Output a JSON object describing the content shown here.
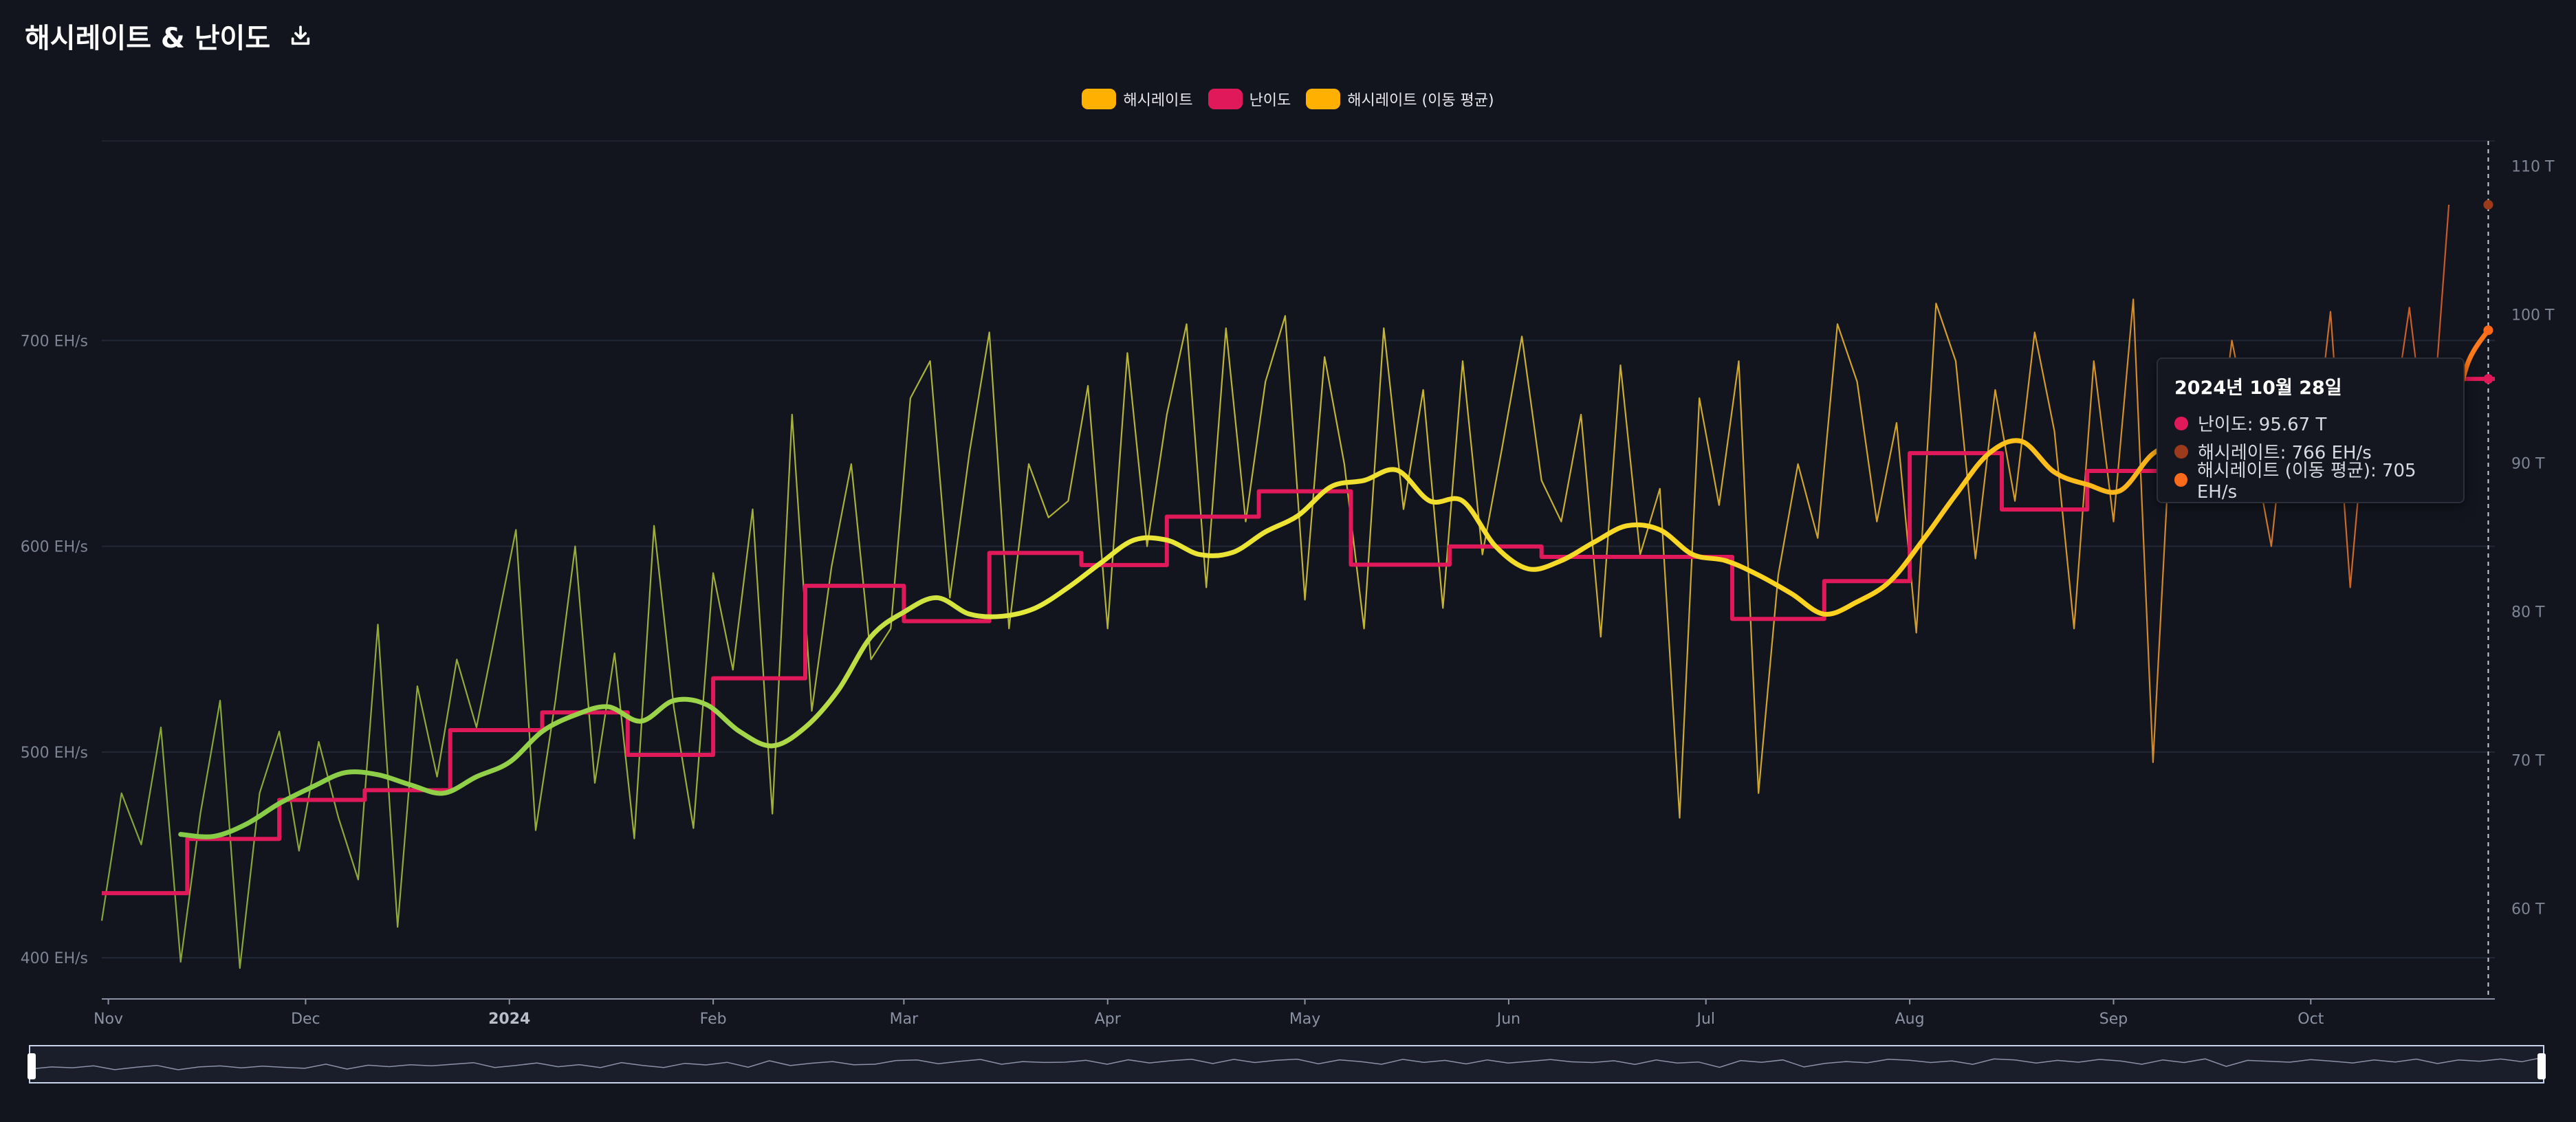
{
  "header": {
    "title": "해시레이트 & 난이도"
  },
  "icons": {
    "download": "download-icon"
  },
  "legend": [
    {
      "label": "해시레이트",
      "color": "#ffb000"
    },
    {
      "label": "난이도",
      "color": "#e0195a"
    },
    {
      "label": "해시레이트 (이동 평균)",
      "color": "#ffb000"
    }
  ],
  "tooltip": {
    "date": "2024년 10월 28일",
    "rows": [
      {
        "text": "난이도: 95.67 T",
        "color": "#e0195a"
      },
      {
        "text": "해시레이트: 766 EH/s",
        "color": "#9c3a1c"
      },
      {
        "text": "해시레이트 (이동 평균): 705 EH/s",
        "color": "#ff6a1a"
      }
    ]
  },
  "chart_data": {
    "type": "line",
    "x_range": [
      "2023-10-31",
      "2024-10-29"
    ],
    "xticks": [
      {
        "label": "Nov",
        "date": "2023-11-01",
        "bold": false
      },
      {
        "label": "Dec",
        "date": "2023-12-01",
        "bold": false
      },
      {
        "label": "2024",
        "date": "2024-01-01",
        "bold": true
      },
      {
        "label": "Feb",
        "date": "2024-02-01",
        "bold": false
      },
      {
        "label": "Mar",
        "date": "2024-03-01",
        "bold": false
      },
      {
        "label": "Apr",
        "date": "2024-04-01",
        "bold": false
      },
      {
        "label": "May",
        "date": "2024-05-01",
        "bold": false
      },
      {
        "label": "Jun",
        "date": "2024-06-01",
        "bold": false
      },
      {
        "label": "Jul",
        "date": "2024-07-01",
        "bold": false
      },
      {
        "label": "Aug",
        "date": "2024-08-01",
        "bold": false
      },
      {
        "label": "Sep",
        "date": "2024-09-01",
        "bold": false
      },
      {
        "label": "Oct",
        "date": "2024-10-01",
        "bold": false
      }
    ],
    "y_left": {
      "unit": "EH/s",
      "ylim": [
        380,
        797
      ],
      "ticks": [
        400,
        500,
        600,
        700
      ]
    },
    "y_right": {
      "unit": "T",
      "ylim": [
        53.9,
        111.7
      ],
      "ticks": [
        60,
        70,
        80,
        90,
        100,
        110
      ]
    },
    "grid": true,
    "legend_position": "top-center",
    "series": [
      {
        "name": "해시레이트",
        "axis": "left",
        "style": "thin-gradient",
        "dates": [
          "2023-10-31",
          "2023-11-03",
          "2023-11-06",
          "2023-11-09",
          "2023-11-12",
          "2023-11-15",
          "2023-11-18",
          "2023-11-21",
          "2023-11-24",
          "2023-11-27",
          "2023-11-30",
          "2023-12-03",
          "2023-12-06",
          "2023-12-09",
          "2023-12-12",
          "2023-12-15",
          "2023-12-18",
          "2023-12-21",
          "2023-12-24",
          "2023-12-27",
          "2023-12-30",
          "2024-01-02",
          "2024-01-05",
          "2024-01-08",
          "2024-01-11",
          "2024-01-14",
          "2024-01-17",
          "2024-01-20",
          "2024-01-23",
          "2024-01-26",
          "2024-01-29",
          "2024-02-01",
          "2024-02-04",
          "2024-02-07",
          "2024-02-10",
          "2024-02-13",
          "2024-02-16",
          "2024-02-19",
          "2024-02-22",
          "2024-02-25",
          "2024-02-28",
          "2024-03-02",
          "2024-03-05",
          "2024-03-08",
          "2024-03-11",
          "2024-03-14",
          "2024-03-17",
          "2024-03-20",
          "2024-03-23",
          "2024-03-26",
          "2024-03-29",
          "2024-04-01",
          "2024-04-04",
          "2024-04-07",
          "2024-04-10",
          "2024-04-13",
          "2024-04-16",
          "2024-04-19",
          "2024-04-22",
          "2024-04-25",
          "2024-04-28",
          "2024-05-01",
          "2024-05-04",
          "2024-05-07",
          "2024-05-10",
          "2024-05-13",
          "2024-05-16",
          "2024-05-19",
          "2024-05-22",
          "2024-05-25",
          "2024-05-28",
          "2024-05-31",
          "2024-06-03",
          "2024-06-06",
          "2024-06-09",
          "2024-06-12",
          "2024-06-15",
          "2024-06-18",
          "2024-06-21",
          "2024-06-24",
          "2024-06-27",
          "2024-06-30",
          "2024-07-03",
          "2024-07-06",
          "2024-07-09",
          "2024-07-12",
          "2024-07-15",
          "2024-07-18",
          "2024-07-21",
          "2024-07-24",
          "2024-07-27",
          "2024-07-30",
          "2024-08-02",
          "2024-08-05",
          "2024-08-08",
          "2024-08-11",
          "2024-08-14",
          "2024-08-17",
          "2024-08-20",
          "2024-08-23",
          "2024-08-26",
          "2024-08-29",
          "2024-09-01",
          "2024-09-04",
          "2024-09-07",
          "2024-09-10",
          "2024-09-13",
          "2024-09-16",
          "2024-09-19",
          "2024-09-22",
          "2024-09-25",
          "2024-09-28",
          "2024-10-01",
          "2024-10-04",
          "2024-10-07",
          "2024-10-10",
          "2024-10-13",
          "2024-10-16",
          "2024-10-19",
          "2024-10-22",
          "2024-10-25",
          "2024-10-28"
        ],
        "values": [
          418,
          480,
          455,
          512,
          398,
          470,
          525,
          395,
          480,
          510,
          452,
          505,
          468,
          438,
          562,
          415,
          532,
          488,
          545,
          512,
          560,
          608,
          462,
          525,
          600,
          485,
          548,
          458,
          610,
          522,
          463,
          587,
          540,
          618,
          470,
          664,
          520,
          590,
          640,
          545,
          560,
          672,
          690,
          575,
          646,
          704,
          560,
          640,
          614,
          622,
          678,
          560,
          694,
          600,
          664,
          708,
          580,
          706,
          612,
          680,
          712,
          574,
          692,
          640,
          560,
          706,
          618,
          676,
          570,
          690,
          596,
          648,
          702,
          632,
          612,
          664,
          556,
          688,
          596,
          628,
          468,
          672,
          620,
          690,
          480,
          586,
          640,
          604,
          708,
          680,
          612,
          660,
          558,
          718,
          690,
          594,
          676,
          622,
          704,
          656,
          560,
          690,
          612,
          720,
          495,
          676,
          650,
          622,
          700,
          652,
          600,
          690,
          628,
          714,
          580,
          690,
          650,
          716,
          636,
          766
        ]
      },
      {
        "name": "해시레이트 (이동 평균)",
        "axis": "left",
        "style": "thick-gradient",
        "dates": [
          "2023-11-12",
          "2023-11-17",
          "2023-11-22",
          "2023-11-27",
          "2023-12-02",
          "2023-12-07",
          "2023-12-12",
          "2023-12-17",
          "2023-12-22",
          "2023-12-27",
          "2024-01-01",
          "2024-01-06",
          "2024-01-11",
          "2024-01-16",
          "2024-01-21",
          "2024-01-26",
          "2024-01-31",
          "2024-02-05",
          "2024-02-10",
          "2024-02-15",
          "2024-02-20",
          "2024-02-25",
          "2024-03-01",
          "2024-03-06",
          "2024-03-11",
          "2024-03-16",
          "2024-03-21",
          "2024-03-26",
          "2024-03-31",
          "2024-04-05",
          "2024-04-10",
          "2024-04-15",
          "2024-04-20",
          "2024-04-25",
          "2024-04-30",
          "2024-05-05",
          "2024-05-10",
          "2024-05-15",
          "2024-05-20",
          "2024-05-25",
          "2024-05-30",
          "2024-06-04",
          "2024-06-09",
          "2024-06-14",
          "2024-06-19",
          "2024-06-24",
          "2024-06-29",
          "2024-07-04",
          "2024-07-09",
          "2024-07-14",
          "2024-07-19",
          "2024-07-24",
          "2024-07-29",
          "2024-08-03",
          "2024-08-08",
          "2024-08-13",
          "2024-08-18",
          "2024-08-23",
          "2024-08-28",
          "2024-09-02",
          "2024-09-07",
          "2024-09-12",
          "2024-09-17",
          "2024-09-22",
          "2024-09-27",
          "2024-10-02",
          "2024-10-07",
          "2024-10-12",
          "2024-10-17",
          "2024-10-22",
          "2024-10-25",
          "2024-10-28"
        ],
        "values": [
          460,
          459,
          465,
          475,
          483,
          490,
          489,
          484,
          480,
          488,
          495,
          510,
          518,
          522,
          515,
          525,
          523,
          510,
          503,
          512,
          530,
          556,
          568,
          575,
          567,
          566,
          570,
          580,
          592,
          603,
          603,
          596,
          597,
          607,
          615,
          629,
          632,
          637,
          622,
          622,
          600,
          589,
          593,
          602,
          610,
          608,
          596,
          593,
          586,
          577,
          567,
          573,
          583,
          603,
          625,
          645,
          651,
          636,
          630,
          627,
          645,
          652,
          654,
          643,
          655,
          665,
          660,
          651,
          648,
          660,
          690,
          705
        ]
      },
      {
        "name": "난이도",
        "axis": "right",
        "style": "step",
        "color": "#e0195a",
        "steps": [
          {
            "from": "2023-10-31",
            "to": "2023-11-13",
            "value": 61.03
          },
          {
            "from": "2023-11-13",
            "to": "2023-11-27",
            "value": 64.68
          },
          {
            "from": "2023-11-27",
            "to": "2023-12-10",
            "value": 67.31
          },
          {
            "from": "2023-12-10",
            "to": "2023-12-23",
            "value": 67.96
          },
          {
            "from": "2023-12-23",
            "to": "2024-01-06",
            "value": 72.01
          },
          {
            "from": "2024-01-06",
            "to": "2024-01-19",
            "value": 73.2
          },
          {
            "from": "2024-01-19",
            "to": "2024-02-01",
            "value": 70.34
          },
          {
            "from": "2024-02-01",
            "to": "2024-02-15",
            "value": 75.5
          },
          {
            "from": "2024-02-15",
            "to": "2024-03-01",
            "value": 81.73
          },
          {
            "from": "2024-03-01",
            "to": "2024-03-14",
            "value": 79.35
          },
          {
            "from": "2024-03-14",
            "to": "2024-03-28",
            "value": 83.95
          },
          {
            "from": "2024-03-28",
            "to": "2024-04-10",
            "value": 83.13
          },
          {
            "from": "2024-04-10",
            "to": "2024-04-24",
            "value": 86.39
          },
          {
            "from": "2024-04-24",
            "to": "2024-05-08",
            "value": 88.1
          },
          {
            "from": "2024-05-08",
            "to": "2024-05-23",
            "value": 83.15
          },
          {
            "from": "2024-05-23",
            "to": "2024-06-06",
            "value": 84.38
          },
          {
            "from": "2024-06-06",
            "to": "2024-06-20",
            "value": 83.68
          },
          {
            "from": "2024-06-20",
            "to": "2024-07-05",
            "value": 83.68
          },
          {
            "from": "2024-07-05",
            "to": "2024-07-19",
            "value": 79.5
          },
          {
            "from": "2024-07-19",
            "to": "2024-08-01",
            "value": 82.05
          },
          {
            "from": "2024-08-01",
            "to": "2024-08-15",
            "value": 90.67
          },
          {
            "from": "2024-08-15",
            "to": "2024-08-28",
            "value": 86.87
          },
          {
            "from": "2024-08-28",
            "to": "2024-09-10",
            "value": 89.47
          },
          {
            "from": "2024-09-10",
            "to": "2024-10-24",
            "value": 89.47
          },
          {
            "from": "2024-10-24",
            "to": "2024-10-29",
            "value": 95.67
          }
        ]
      }
    ],
    "crosshair_date": "2024-10-28"
  }
}
